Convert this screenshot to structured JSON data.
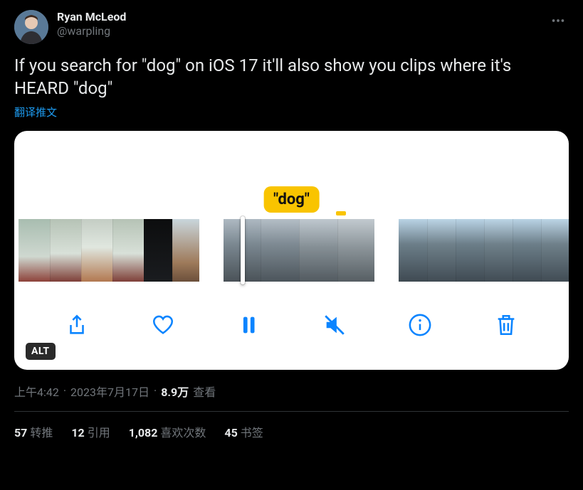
{
  "author": {
    "display_name": "Ryan McLeod",
    "handle": "@warpling"
  },
  "content": {
    "text": "If you search for \"dog\" on iOS 17 it'll also show you clips where it's HEARD \"dog\"",
    "translate_label": "翻译推文"
  },
  "media": {
    "caption": "\"dog\"",
    "alt_badge": "ALT"
  },
  "meta": {
    "time": "上午4:42",
    "date": "2023年7月17日",
    "views_count": "8.9万",
    "views_label": "查看"
  },
  "engagement": {
    "retweets": {
      "count": "57",
      "label": "转推"
    },
    "quotes": {
      "count": "12",
      "label": "引用"
    },
    "likes": {
      "count": "1,082",
      "label": "喜欢次数"
    },
    "bookmarks": {
      "count": "45",
      "label": "书签"
    }
  }
}
